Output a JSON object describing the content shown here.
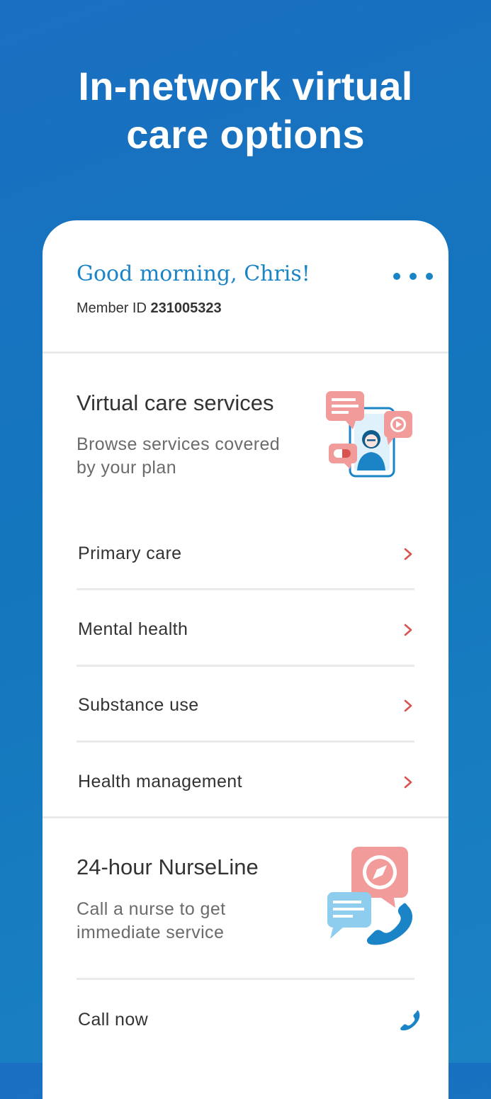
{
  "hero": {
    "headline_line1": "In-network virtual",
    "headline_line2": "care options"
  },
  "header": {
    "greeting": "Good morning, Chris!",
    "member_label": "Member ID",
    "member_id": "231005323",
    "menu_icon": "more-horizontal-icon"
  },
  "virtual_care": {
    "title": "Virtual care services",
    "subtitle_line1": "Browse services covered",
    "subtitle_line2": "by your plan",
    "items": [
      {
        "label": "Primary care",
        "icon": "chevron-right-icon"
      },
      {
        "label": "Mental health",
        "icon": "chevron-right-icon"
      },
      {
        "label": "Substance use",
        "icon": "chevron-right-icon"
      },
      {
        "label": "Health management",
        "icon": "chevron-right-icon"
      }
    ]
  },
  "nurseline": {
    "title": "24-hour NurseLine",
    "subtitle_line1": "Call a nurse to get",
    "subtitle_line2": "immediate service",
    "action_label": "Call now",
    "action_icon": "phone-icon"
  },
  "colors": {
    "background": "#1a6fc2",
    "accent": "#1a84c7",
    "chevron": "#d9534f",
    "illustration_pink": "#f19c9a"
  }
}
